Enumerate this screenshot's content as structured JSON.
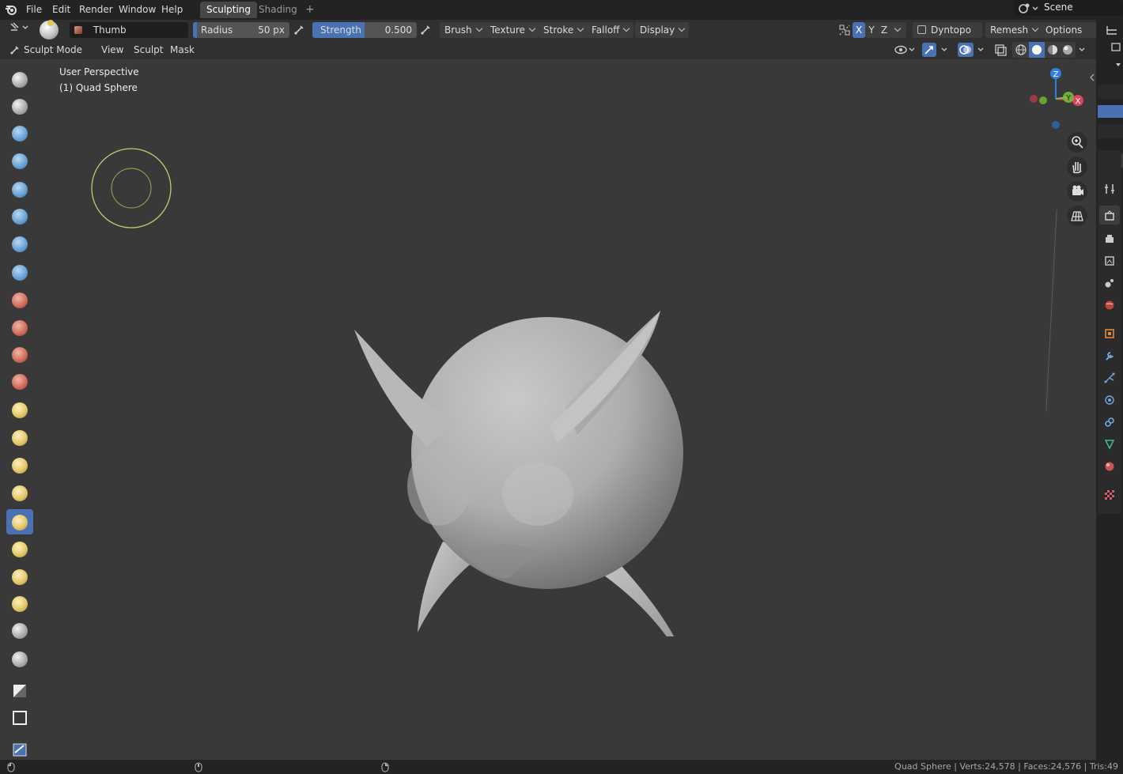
{
  "menubar": {
    "items": [
      "File",
      "Edit",
      "Render",
      "Window",
      "Help"
    ],
    "workspace_tabs": [
      "Sculpting",
      "Shading"
    ],
    "add_tab": "+",
    "scene": "Scene"
  },
  "tool_header": {
    "brush_name": "Thumb",
    "radius_label": "Radius",
    "radius_value": "50 px",
    "strength_label": "Strength",
    "strength_value": "0.500",
    "menus": [
      "Brush",
      "Texture",
      "Stroke",
      "Falloff",
      "Display"
    ],
    "symmetry_axes": [
      "X",
      "Y",
      "Z"
    ],
    "dyntopo": "Dyntopo",
    "remesh": "Remesh",
    "options": "Options"
  },
  "mode_header": {
    "mode": "Sculpt Mode",
    "menus": [
      "View",
      "Sculpt",
      "Mask"
    ]
  },
  "viewport": {
    "view_name": "User Perspective",
    "object_name": "(1) Quad Sphere",
    "gizmo": {
      "z": "Z",
      "y": "Y",
      "x": "X"
    },
    "colors": {
      "background": "#393939",
      "brush_circle": "#c8c86e",
      "active_tool": "#4a72b2",
      "gizmo_x": "#d6455a",
      "gizmo_y": "#7dc23a",
      "gizmo_z": "#2f7fe0"
    }
  },
  "tools": [
    "draw",
    "draw-sharp",
    "clay",
    "clay-strips",
    "clay-thumb",
    "layer",
    "inflate",
    "blob",
    "crease",
    "smooth",
    "flatten",
    "fill",
    "scrape",
    "multiplane-scrape",
    "pinch",
    "grab",
    "elastic-deform",
    "snake-hook",
    "thumb",
    "pose",
    "nudge",
    "rotate",
    "slide-relax",
    "boundary",
    "mask",
    "box-mask",
    "annotate"
  ],
  "active_tool": "thumb",
  "status": {
    "text": "Quad Sphere | Verts:24,578 | Faces:24,576 | Tris:49"
  }
}
